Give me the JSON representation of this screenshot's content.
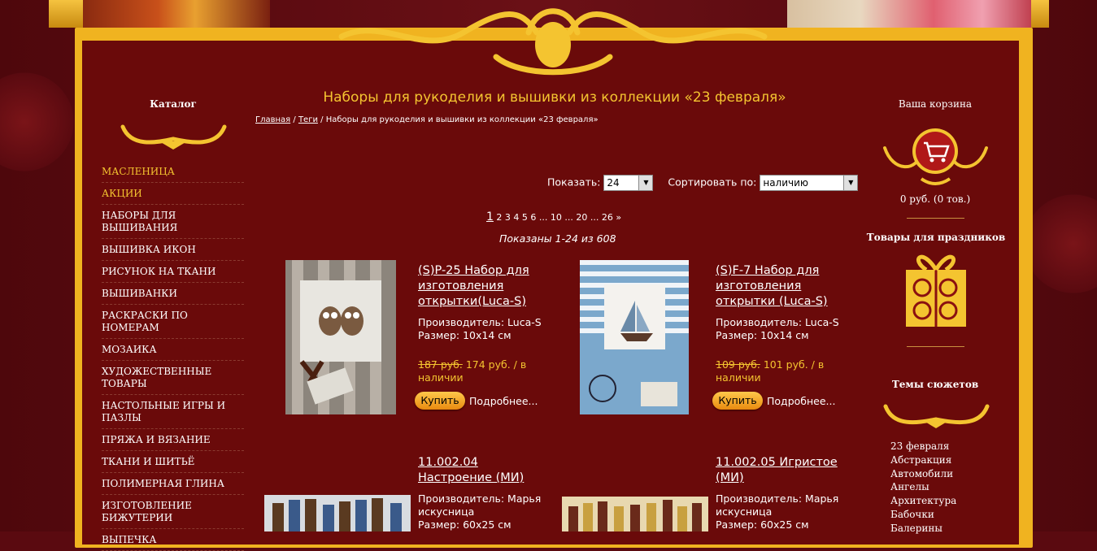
{
  "header": {
    "title": "Наборы для рукоделия и вышивки из коллекции «23 февраля»"
  },
  "breadcrumb": {
    "home": "Главная",
    "sep1": " / ",
    "tags": "Теги",
    "sep2": " / ",
    "current": "Наборы для рукоделия и вышивки из коллекции «23 февраля»"
  },
  "catalog": {
    "title": "Каталог",
    "items": [
      "МАСЛЕНИЦА",
      "АКЦИИ",
      "НАБОРЫ ДЛЯ ВЫШИВАНИЯ",
      "ВЫШИВКА ИКОН",
      "РИСУНОК НА ТКАНИ",
      "ВЫШИВАНКИ",
      "РАСКРАСКИ ПО НОМЕРАМ",
      "МОЗАИКА",
      "ХУДОЖЕСТВЕННЫЕ ТОВАРЫ",
      "НАСТОЛЬНЫЕ ИГРЫ И ПАЗЛЫ",
      "ПРЯЖА И ВЯЗАНИЕ",
      "ТКАНИ И ШИТЬЁ",
      "ПОЛИМЕРНАЯ ГЛИНА",
      "ИЗГОТОВЛЕНИЕ БИЖУТЕРИИ",
      "ВЫПЕЧКА"
    ]
  },
  "controls": {
    "show_label": "Показать:",
    "show_value": "24",
    "sort_label": "Сортировать по:",
    "sort_value": "наличию"
  },
  "pager": {
    "current": "1",
    "rest": "2 3 4 5 6 ... 10 ... 20 ... 26 »"
  },
  "shown_text": "Показаны 1-24 из 608",
  "products": [
    {
      "title": "(S)P-25 Набор для изготовления открытки(Luca-S)",
      "maker": "Производитель: Luca-S",
      "size": "Размер: 10х14 см",
      "old_price": "187 руб.",
      "price": "174 руб. / в наличии",
      "buy": "Купить",
      "more": "Подробнее..."
    },
    {
      "title": "(S)F-7 Набор для изготовления открытки (Luca-S)",
      "maker": "Производитель: Luca-S",
      "size": "Размер: 10х14 см",
      "old_price": "109 руб.",
      "price": "101 руб. / в наличии",
      "buy": "Купить",
      "more": "Подробнее..."
    },
    {
      "title": "11.002.04 Настроение (МИ)",
      "maker": "Производитель: Марья искусница",
      "size": "Размер: 60х25 см"
    },
    {
      "title": "11.002.05 Игристое (МИ)",
      "maker": "Производитель: Марья искусница",
      "size": "Размер: 60х25 см"
    }
  ],
  "cart": {
    "title": "Ваша корзина",
    "summary": "0 руб.   (0 тов.)"
  },
  "holidays": {
    "title": "Товары для праздников"
  },
  "themes": {
    "title": "Темы сюжетов",
    "items": [
      "23 февраля",
      "Абстракция",
      "Автомобили",
      "Ангелы",
      "Архитектура",
      "Бабочки",
      "Балерины"
    ]
  },
  "colors": {
    "accent": "#f4c430",
    "bg": "#6a0a0a",
    "frame": "#f0b320"
  }
}
